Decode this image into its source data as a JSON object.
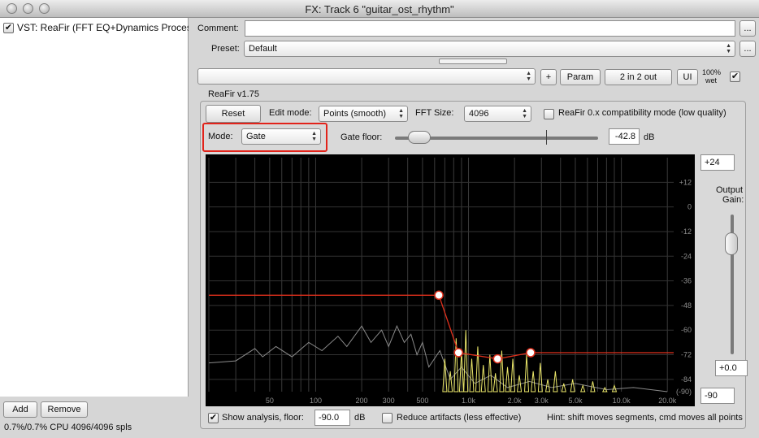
{
  "window": {
    "title": "FX: Track 6 \"guitar_ost_rhythm\""
  },
  "fx_list": {
    "items": [
      {
        "label": "VST: ReaFir (FFT EQ+Dynamics Processor)",
        "enabled": true
      }
    ]
  },
  "left_bottom": {
    "add_label": "Add",
    "remove_label": "Remove",
    "cpu_status": "0.7%/0.7% CPU 4096/4096 spls"
  },
  "header": {
    "comment_label": "Comment:",
    "comment_value": "",
    "preset_label": "Preset:",
    "preset_value": "Default",
    "more_label": "...",
    "plus_label": "+",
    "param_label": "Param",
    "io_label": "2 in 2 out",
    "ui_label": "UI",
    "wet_label": "100%",
    "wet_sub": "wet",
    "plugin_version": "ReaFir v1.75"
  },
  "controls": {
    "reset_label": "Reset",
    "edit_mode_label": "Edit mode:",
    "edit_mode_value": "Points (smooth)",
    "fft_size_label": "FFT Size:",
    "fft_size_value": "4096",
    "compat_label": "ReaFir 0.x compatibility mode (low quality)",
    "mode_label": "Mode:",
    "mode_value": "Gate",
    "gate_floor_label": "Gate floor:",
    "gate_floor_value": "-42.8",
    "gate_floor_unit": "dB",
    "gate_floor_level": 0.12
  },
  "right_controls": {
    "top_value": "+24",
    "output_gain_label1": "Output",
    "output_gain_label2": "Gain:",
    "output_gain_value": "+0.0",
    "bottom_value": "-90",
    "output_gain_level": 0.79
  },
  "footer": {
    "show_analysis_label": "Show analysis, floor:",
    "floor_value": "-90.0",
    "floor_unit": "dB",
    "reduce_label": "Reduce artifacts (less effective)",
    "hint": "Hint: shift moves segments, cmd moves all points"
  },
  "colors": {
    "curve": "#e0301c",
    "spectrum": "#ece86a",
    "analysis": "#8a8a8a",
    "highlight": "#e2231a"
  },
  "chart_data": {
    "type": "line",
    "xscale": "log",
    "xlim": [
      20,
      22000
    ],
    "ylim": [
      -90,
      24
    ],
    "x_ticks": [
      {
        "v": 50,
        "label": "50"
      },
      {
        "v": 100,
        "label": "100"
      },
      {
        "v": 200,
        "label": "200"
      },
      {
        "v": 300,
        "label": "300"
      },
      {
        "v": 500,
        "label": "500"
      },
      {
        "v": 1000,
        "label": "1.0k"
      },
      {
        "v": 2000,
        "label": "2.0k"
      },
      {
        "v": 3000,
        "label": "3.0k"
      },
      {
        "v": 5000,
        "label": "5.0k"
      },
      {
        "v": 10000,
        "label": "10.0k"
      },
      {
        "v": 20000,
        "label": "20.0k"
      }
    ],
    "y_ticks": [
      {
        "v": 12,
        "label": "+12"
      },
      {
        "v": 0,
        "label": "0"
      },
      {
        "v": -12,
        "label": "-12"
      },
      {
        "v": -24,
        "label": "-24"
      },
      {
        "v": -36,
        "label": "-36"
      },
      {
        "v": -48,
        "label": "-48"
      },
      {
        "v": -60,
        "label": "-60"
      },
      {
        "v": -72,
        "label": "-72"
      },
      {
        "v": -84,
        "label": "-84"
      },
      {
        "v": -90,
        "label": "(-90)"
      }
    ],
    "gate_curve": {
      "points": [
        [
          20,
          -43
        ],
        [
          640,
          -43
        ],
        [
          860,
          -71
        ],
        [
          1550,
          -74
        ],
        [
          2550,
          -71
        ],
        [
          22000,
          -71
        ]
      ],
      "handles": [
        [
          640,
          -43
        ],
        [
          860,
          -71
        ],
        [
          1550,
          -74
        ],
        [
          2550,
          -71
        ]
      ]
    },
    "analysis": [
      [
        20,
        -76
      ],
      [
        30,
        -75
      ],
      [
        40,
        -69
      ],
      [
        45,
        -73
      ],
      [
        55,
        -68
      ],
      [
        70,
        -73
      ],
      [
        90,
        -66
      ],
      [
        110,
        -70
      ],
      [
        140,
        -63
      ],
      [
        160,
        -68
      ],
      [
        200,
        -58
      ],
      [
        230,
        -66
      ],
      [
        270,
        -60
      ],
      [
        300,
        -68
      ],
      [
        340,
        -58
      ],
      [
        380,
        -66
      ],
      [
        420,
        -62
      ],
      [
        460,
        -72
      ],
      [
        500,
        -66
      ],
      [
        550,
        -78
      ],
      [
        650,
        -70
      ],
      [
        760,
        -84
      ],
      [
        900,
        -78
      ],
      [
        1100,
        -86
      ],
      [
        1400,
        -82
      ],
      [
        1800,
        -88
      ],
      [
        2500,
        -85
      ],
      [
        3500,
        -88
      ],
      [
        5000,
        -86
      ],
      [
        8000,
        -89
      ],
      [
        12000,
        -88
      ],
      [
        20000,
        -90
      ]
    ],
    "spectrum_peaks": [
      {
        "f": 700,
        "db": -74
      },
      {
        "f": 760,
        "db": -80
      },
      {
        "f": 830,
        "db": -64
      },
      {
        "f": 900,
        "db": -70
      },
      {
        "f": 960,
        "db": -60
      },
      {
        "f": 1050,
        "db": -74
      },
      {
        "f": 1150,
        "db": -68
      },
      {
        "f": 1250,
        "db": -77
      },
      {
        "f": 1380,
        "db": -72
      },
      {
        "f": 1500,
        "db": -81
      },
      {
        "f": 1650,
        "db": -70
      },
      {
        "f": 1800,
        "db": -78
      },
      {
        "f": 1950,
        "db": -74
      },
      {
        "f": 2150,
        "db": -82
      },
      {
        "f": 2400,
        "db": -72
      },
      {
        "f": 2650,
        "db": -80
      },
      {
        "f": 2950,
        "db": -76
      },
      {
        "f": 3300,
        "db": -84
      },
      {
        "f": 3700,
        "db": -80
      },
      {
        "f": 4200,
        "db": -86
      },
      {
        "f": 4800,
        "db": -84
      },
      {
        "f": 5600,
        "db": -87
      },
      {
        "f": 6500,
        "db": -85
      },
      {
        "f": 7800,
        "db": -88
      },
      {
        "f": 9000,
        "db": -87
      }
    ]
  }
}
